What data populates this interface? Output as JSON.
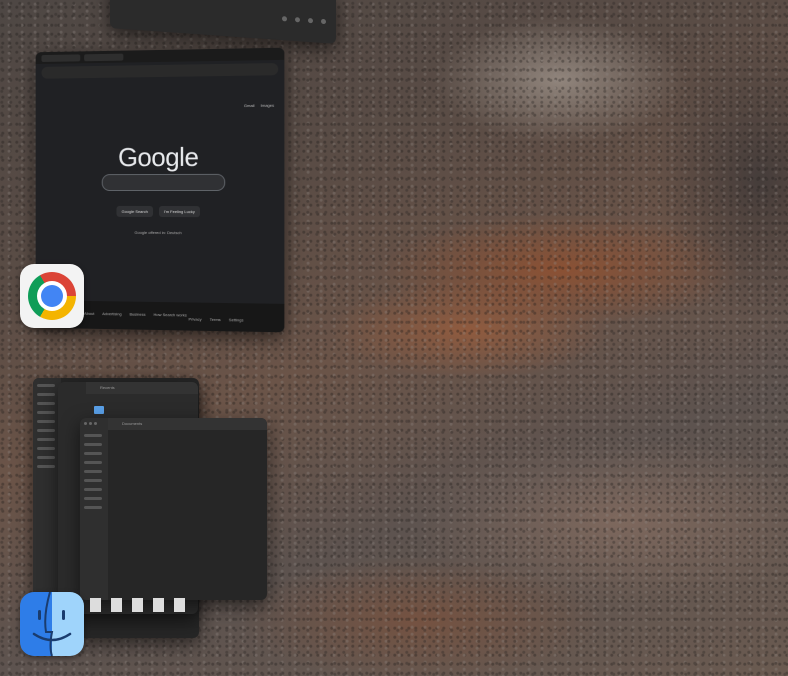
{
  "desktop": {
    "wallpaper": "rocky mountainside"
  },
  "chrome_window": {
    "logo": "Google",
    "top_links": [
      "Gmail",
      "Images"
    ],
    "buttons": [
      "Google Search",
      "I'm Feeling Lucky"
    ],
    "offered": "Google offered in: Deutsch",
    "footer_left": [
      "About",
      "Advertising",
      "Business",
      "How Search works"
    ],
    "footer_right": [
      "Privacy",
      "Terms",
      "Settings"
    ]
  },
  "finder_window": {
    "title1": "Recents",
    "title2": "Documents",
    "folder_label": "Folder"
  },
  "dock": {
    "chrome_icon": "chrome-icon",
    "finder_icon": "finder-icon"
  }
}
